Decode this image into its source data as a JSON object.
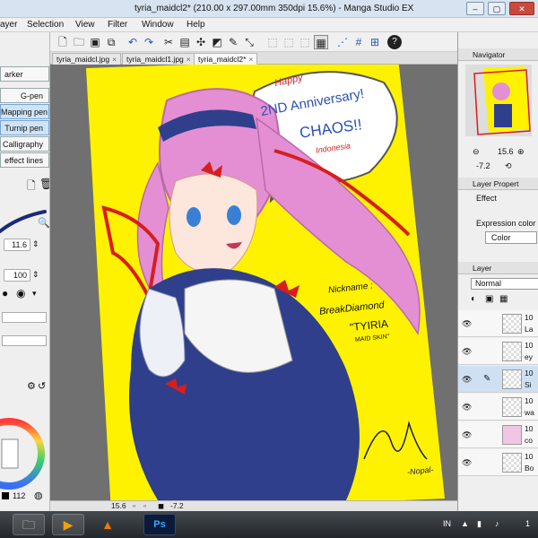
{
  "window": {
    "title": "tyria_maidcl2* (210.00 x 297.00mm 350dpi 15.6%) - Manga Studio EX",
    "controls": [
      "–",
      "▢",
      "✕"
    ]
  },
  "menubar": {
    "items": [
      "ayer",
      "Selection",
      "View",
      "Filter",
      "Window",
      "Help"
    ]
  },
  "tabs": [
    {
      "label": "tyria_maidcl.jpg"
    },
    {
      "label": "tyria_maidcl1.jpg"
    },
    {
      "label": "tyria_maidcl2*"
    }
  ],
  "left_panel": {
    "tool_label": "arker",
    "sub_tools": [
      "G-pen",
      "Mapping pen",
      "Turnip pen",
      "Calligraphy",
      "effect lines"
    ],
    "brush_size": "11.6",
    "opacity": "100"
  },
  "artwork": {
    "speech_lines": [
      "Happy",
      "2ND Anniversary!",
      "CHAOS!!",
      "Indonesia"
    ],
    "nickname_label": "Nickname :",
    "nickname_value": "BreakDiamond",
    "character_name": "\"TYIRIA",
    "character_sub": "MAID SKIN\"",
    "signature": "-Nopal-",
    "background_color": "#fff200",
    "hair_color": "#e48fd3",
    "dress_color": "#2f3f8c",
    "ribbon_color": "#d71e1e"
  },
  "status": {
    "zoom": "15.6",
    "angle": "-7.2",
    "color_value": "112"
  },
  "right_panel": {
    "navigator_tab": "Navigator",
    "nav_zoom": "15.6",
    "nav_angle": "-7.2",
    "layer_property_tab": "Layer Propert",
    "effect_label": "Effect",
    "expression_label": "Expression color",
    "color_option": "Color",
    "layer_tab": "Layer",
    "blend_mode": "Normal",
    "layers": [
      {
        "percent": "10",
        "name": "La"
      },
      {
        "percent": "10",
        "name": "ey"
      },
      {
        "percent": "10",
        "name": "Si"
      },
      {
        "percent": "10",
        "name": "wa"
      },
      {
        "percent": "10",
        "name": "co"
      },
      {
        "percent": "10",
        "name": "Bo"
      }
    ]
  },
  "taskbar": {
    "language": "IN",
    "time": "1"
  }
}
